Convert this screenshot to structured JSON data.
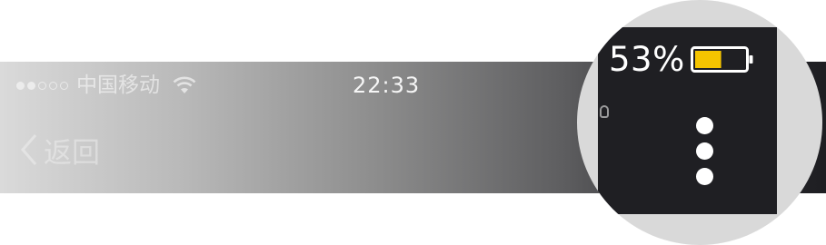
{
  "status_bar": {
    "signal_dots_filled": 2,
    "signal_dots_total": 5,
    "carrier": "中国移动",
    "time": "22:33",
    "battery_percent_label": "53%",
    "battery_level": 0.53
  },
  "nav": {
    "back_label": "返回"
  },
  "magnifier": {
    "battery_percent_label": "53%"
  },
  "colors": {
    "battery_fill": "#f5c400",
    "magnifier_bg": "#1f1f23"
  }
}
